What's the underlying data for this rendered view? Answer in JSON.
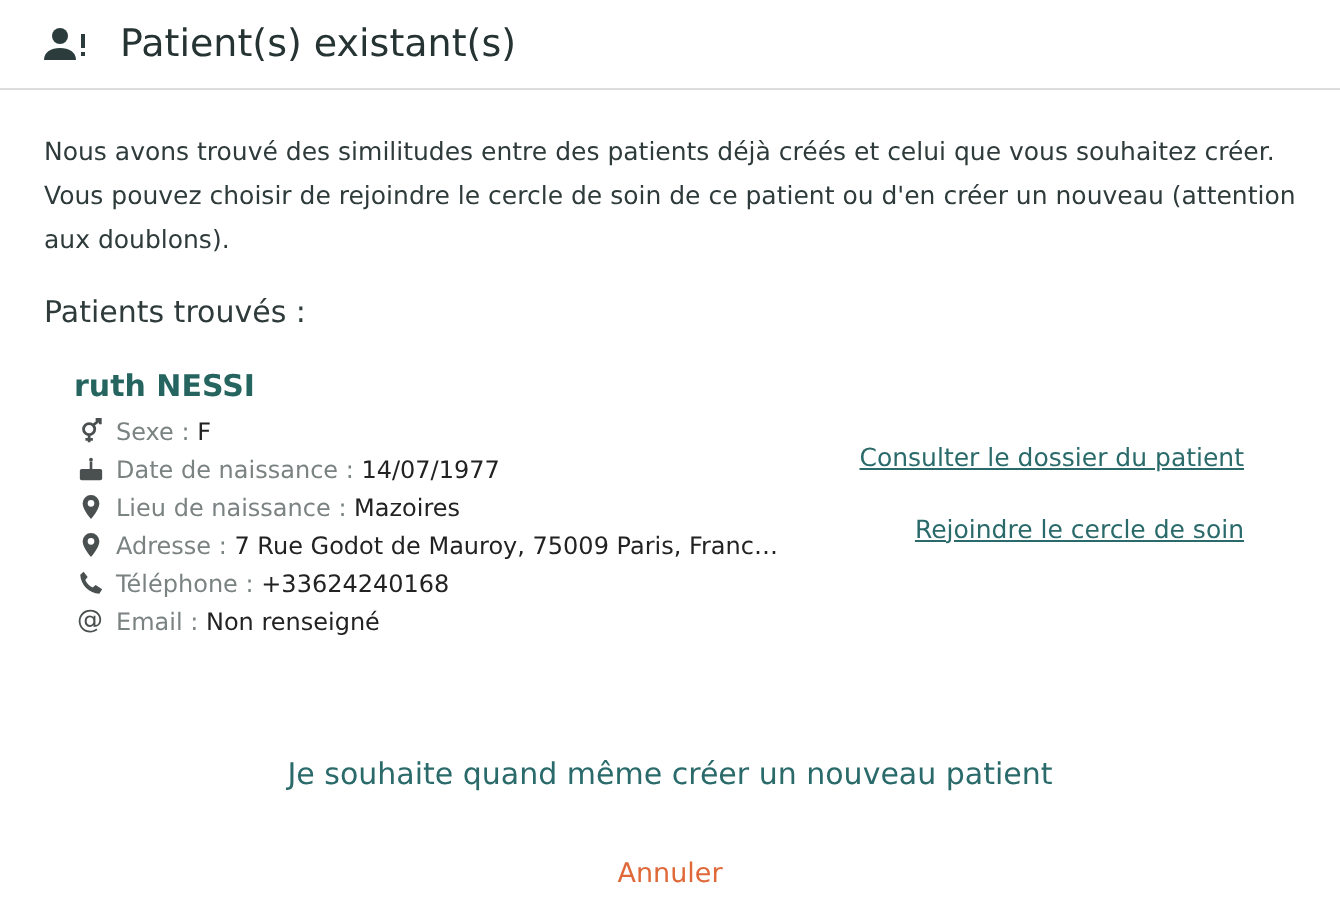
{
  "dialog": {
    "title": "Patient(s) existant(s)"
  },
  "intro": "Nous avons trouvé des similitudes entre des patients déjà créés et celui que vous souhaitez créer. Vous pouvez choisir de rejoindre le cercle de soin de ce patient ou d'en créer un nouveau (attention aux doublons).",
  "found_heading": "Patients trouvés :",
  "patients": [
    {
      "name": "ruth NESSI",
      "fields": [
        {
          "kind": "gender",
          "label": "Sexe :",
          "value": "F"
        },
        {
          "kind": "birthday",
          "label": "Date de naissance :",
          "value": "14/07/1977"
        },
        {
          "kind": "place",
          "label": "Lieu de naissance :",
          "value": "Mazoires"
        },
        {
          "kind": "place",
          "label": "Adresse :",
          "value": "7 Rue Godot de Mauroy, 75009 Paris, Franc…"
        },
        {
          "kind": "phone",
          "label": "Téléphone :",
          "value": "+33624240168"
        },
        {
          "kind": "email",
          "icon_text": "@",
          "label": "Email :",
          "value": "Non renseigné"
        }
      ],
      "links": [
        "Consulter le dossier du patient",
        "Rejoindre le cercle de soin"
      ]
    }
  ],
  "create_link": "Je souhaite quand même créer un nouveau patient",
  "cancel_link": "Annuler"
}
